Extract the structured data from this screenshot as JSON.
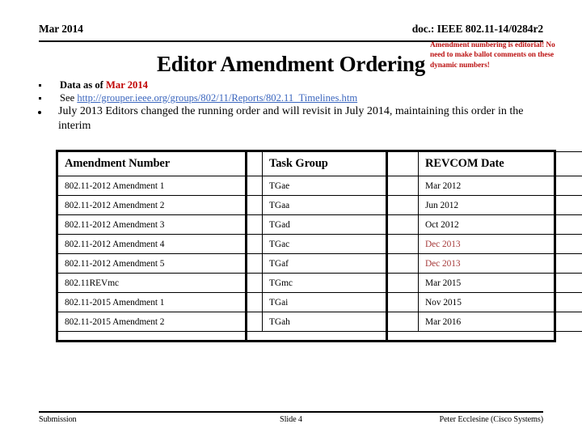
{
  "header": {
    "date": "Mar 2014",
    "doc_id": "doc.: IEEE 802.11-14/0284r2"
  },
  "title": "Editor Amendment Ordering",
  "annotation": {
    "text": "Amendment numbering is editorial! No need to make ballot comments on these dynamic numbers!",
    "color": "#BB1111"
  },
  "bullets": {
    "b1_prefix": "Data as of ",
    "b1_highlight": "Mar 2014",
    "b2_prefix": "See ",
    "b2_link": "http://grouper.ieee.org/groups/802/11/Reports/802.11_Timelines.htm",
    "b3": "July 2013 Editors changed the running order and will revisit in July 2014, maintaining this order in the interim"
  },
  "table": {
    "columns": [
      "Amendment Number",
      "Task Group",
      "REVCOM Date"
    ],
    "rows": [
      {
        "amendment": "802.11-2012 Amendment 1",
        "task_group": "TGae",
        "revcom_date": "Mar 2012",
        "highlight": false
      },
      {
        "amendment": "802.11-2012 Amendment 2",
        "task_group": "TGaa",
        "revcom_date": "Jun 2012",
        "highlight": false
      },
      {
        "amendment": "802.11-2012 Amendment 3",
        "task_group": "TGad",
        "revcom_date": "Oct 2012",
        "highlight": false
      },
      {
        "amendment": "802.11-2012 Amendment 4",
        "task_group": "TGac",
        "revcom_date": "Dec 2013",
        "highlight": true
      },
      {
        "amendment": "802.11-2012 Amendment 5",
        "task_group": "TGaf",
        "revcom_date": "Dec 2013",
        "highlight": true
      },
      {
        "amendment": "802.11REVmc",
        "task_group": "TGmc",
        "revcom_date": "Mar 2015",
        "highlight": false
      },
      {
        "amendment": "802.11-2015 Amendment 1",
        "task_group": "TGai",
        "revcom_date": "Nov 2015",
        "highlight": false
      },
      {
        "amendment": "802.11-2015 Amendment 2",
        "task_group": "TGah",
        "revcom_date": "Mar 2016",
        "highlight": false
      }
    ],
    "highlight_color": "#A63A3A"
  },
  "footer": {
    "left": "Submission",
    "center": "Slide 4",
    "right": "Peter Ecclesine (Cisco Systems)"
  }
}
